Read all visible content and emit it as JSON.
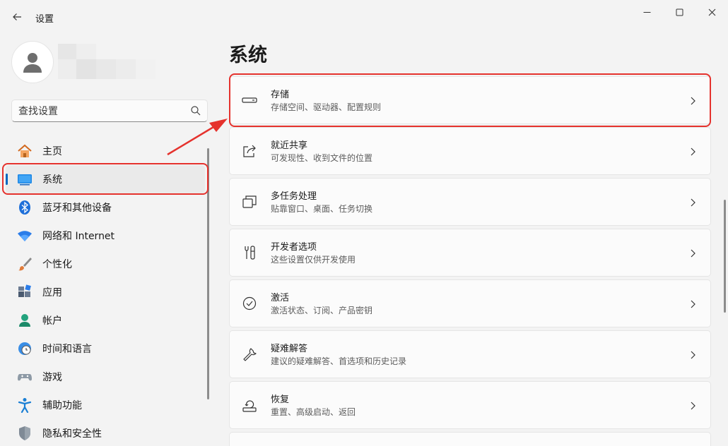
{
  "window": {
    "title": "设置"
  },
  "search": {
    "placeholder": "查找设置"
  },
  "nav": {
    "items": [
      {
        "label": "主页",
        "icon": "home-icon"
      },
      {
        "label": "系统",
        "icon": "system-monitor-icon"
      },
      {
        "label": "蓝牙和其他设备",
        "icon": "bluetooth-icon"
      },
      {
        "label": "网络和 Internet",
        "icon": "wifi-icon"
      },
      {
        "label": "个性化",
        "icon": "brush-icon"
      },
      {
        "label": "应用",
        "icon": "apps-icon"
      },
      {
        "label": "帐户",
        "icon": "account-icon"
      },
      {
        "label": "时间和语言",
        "icon": "globe-clock-icon"
      },
      {
        "label": "游戏",
        "icon": "gamepad-icon"
      },
      {
        "label": "辅助功能",
        "icon": "accessibility-icon"
      },
      {
        "label": "隐私和安全性",
        "icon": "shield-icon"
      }
    ],
    "selected_index": 1
  },
  "main": {
    "title": "系统",
    "cards": [
      {
        "title": "存储",
        "subtitle": "存储空间、驱动器、配置规则",
        "icon": "storage-drive-icon"
      },
      {
        "title": "就近共享",
        "subtitle": "可发现性、收到文件的位置",
        "icon": "share-icon"
      },
      {
        "title": "多任务处理",
        "subtitle": "贴靠窗口、桌面、任务切换",
        "icon": "multitask-icon"
      },
      {
        "title": "开发者选项",
        "subtitle": "这些设置仅供开发使用",
        "icon": "developer-tools-icon"
      },
      {
        "title": "激活",
        "subtitle": "激活状态、订阅、产品密钥",
        "icon": "check-circle-icon"
      },
      {
        "title": "疑难解答",
        "subtitle": "建议的疑难解答、首选项和历史记录",
        "icon": "wrench-icon"
      },
      {
        "title": "恢复",
        "subtitle": "重置、高级启动、返回",
        "icon": "recovery-icon"
      }
    ]
  },
  "colors": {
    "accent": "#0067c0",
    "annotation": "#e5322d",
    "background": "#f3f3f3",
    "card": "#fbfbfb"
  }
}
